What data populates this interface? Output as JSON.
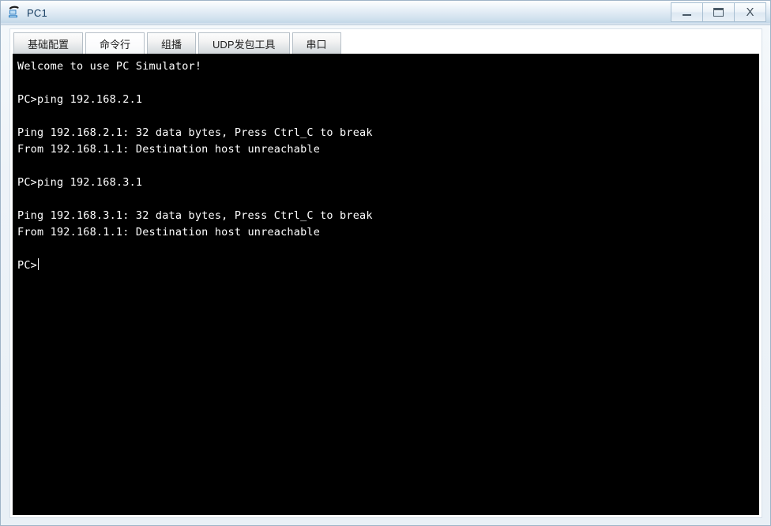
{
  "window": {
    "title": "PC1",
    "icon": "pc-simulator-icon",
    "controls": {
      "minimize_label": "—",
      "maximize_label": "□",
      "close_label": "X"
    }
  },
  "tabs": [
    {
      "label": "基础配置",
      "active": false
    },
    {
      "label": "命令行",
      "active": true
    },
    {
      "label": "组播",
      "active": false
    },
    {
      "label": "UDP发包工具",
      "active": false
    },
    {
      "label": "串口",
      "active": false
    }
  ],
  "terminal": {
    "background_color": "#000000",
    "text_color": "#ffffff",
    "lines": [
      "Welcome to use PC Simulator!",
      "",
      "PC>ping 192.168.2.1",
      "",
      "Ping 192.168.2.1: 32 data bytes, Press Ctrl_C to break",
      "From 192.168.1.1: Destination host unreachable",
      "",
      "PC>ping 192.168.3.1",
      "",
      "Ping 192.168.3.1: 32 data bytes, Press Ctrl_C to break",
      "From 192.168.1.1: Destination host unreachable",
      ""
    ],
    "prompt": "PC>"
  }
}
